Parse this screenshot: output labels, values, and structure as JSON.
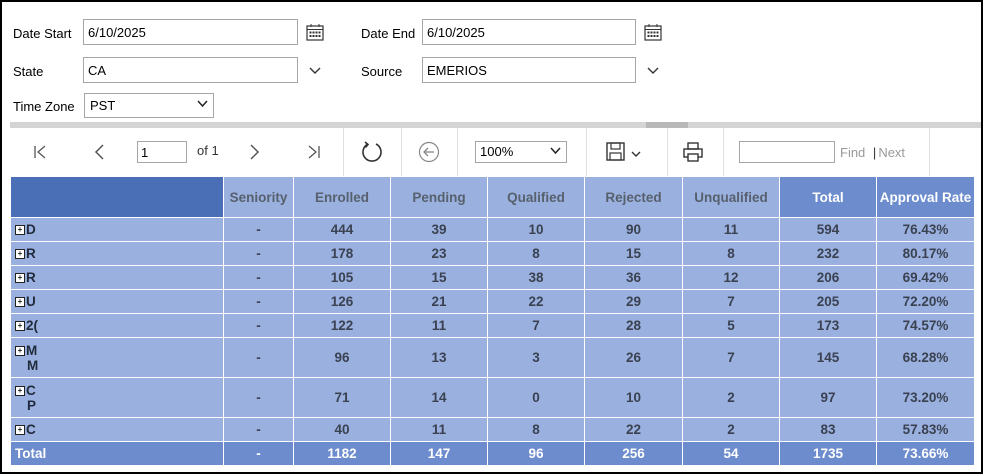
{
  "params": {
    "date_start_label": "Date Start",
    "date_start_value": "6/10/2025",
    "date_end_label": "Date End",
    "date_end_value": "6/10/2025",
    "state_label": "State",
    "state_value": "CA",
    "source_label": "Source",
    "source_value": "EMERIOS",
    "timezone_label": "Time Zone",
    "timezone_value": "PST"
  },
  "toolbar": {
    "page_number": "1",
    "of_pages": "of 1",
    "zoom": "100%",
    "find_label": "Find",
    "next_label": "Next",
    "find_separator": "|"
  },
  "table": {
    "headers": [
      "",
      "Seniority",
      "Enrolled",
      "Pending",
      "Qualified",
      "Rejected",
      "Unqualified",
      "Total",
      "Approval Rate"
    ],
    "rows": [
      {
        "name": "D",
        "name2": "",
        "cells": [
          "-",
          "444",
          "39",
          "10",
          "90",
          "11",
          "594",
          "76.43%"
        ]
      },
      {
        "name": "R",
        "name2": "",
        "cells": [
          "-",
          "178",
          "23",
          "8",
          "15",
          "8",
          "232",
          "80.17%"
        ]
      },
      {
        "name": "R",
        "name2": "",
        "cells": [
          "-",
          "105",
          "15",
          "38",
          "36",
          "12",
          "206",
          "69.42%"
        ]
      },
      {
        "name": "U",
        "name2": "",
        "cells": [
          "-",
          "126",
          "21",
          "22",
          "29",
          "7",
          "205",
          "72.20%"
        ]
      },
      {
        "name": "2(",
        "name2": "",
        "cells": [
          "-",
          "122",
          "11",
          "7",
          "28",
          "5",
          "173",
          "74.57%"
        ]
      },
      {
        "name": "M",
        "name2": "M",
        "cells": [
          "-",
          "96",
          "13",
          "3",
          "26",
          "7",
          "145",
          "68.28%"
        ]
      },
      {
        "name": "C",
        "name2": "P",
        "cells": [
          "-",
          "71",
          "14",
          "0",
          "10",
          "2",
          "97",
          "73.20%"
        ]
      },
      {
        "name": "C",
        "name2": "",
        "cells": [
          "-",
          "40",
          "11",
          "8",
          "22",
          "2",
          "83",
          "57.83%"
        ]
      }
    ],
    "total": {
      "name": "Total",
      "cells": [
        "-",
        "1182",
        "147",
        "96",
        "256",
        "54",
        "1735",
        "73.66%"
      ]
    }
  }
}
